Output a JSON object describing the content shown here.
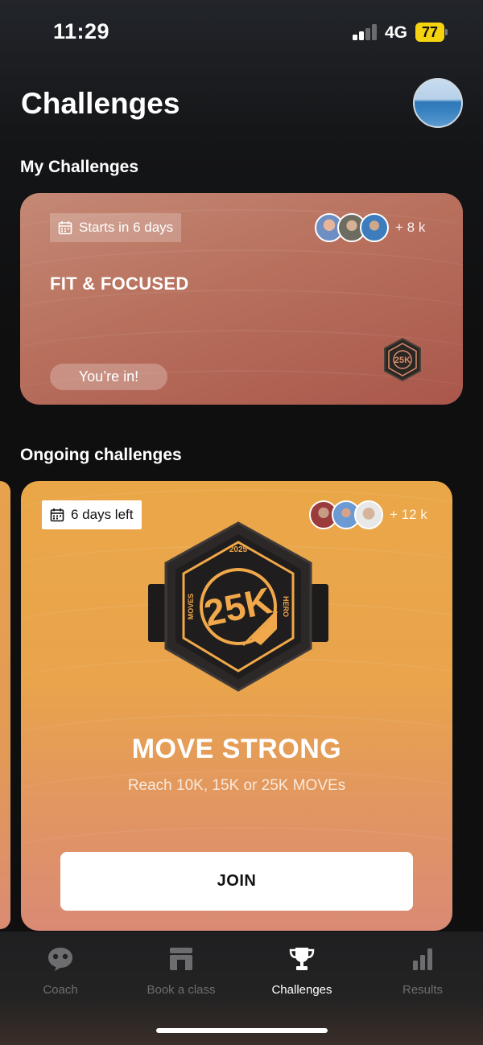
{
  "status_bar": {
    "time": "11:29",
    "network": "4G",
    "battery": "77"
  },
  "header": {
    "title": "Challenges"
  },
  "my_challenges": {
    "section_title": "My Challenges",
    "card": {
      "date_label": "Starts in 6 days",
      "participants": "+ 8 k",
      "title": "FIT & FOCUSED",
      "status": "You’re in!"
    }
  },
  "ongoing": {
    "section_title": "Ongoing challenges",
    "card": {
      "date_label": "6 days left",
      "participants": "+ 12 k",
      "badge": {
        "year": "2025",
        "value": "25K",
        "left": "MOVES",
        "right": "HERO"
      },
      "title": "MOVE STRONG",
      "subtitle": "Reach 10K, 15K or 25K MOVEs",
      "join_label": "JOIN"
    }
  },
  "tab_bar": {
    "tabs": [
      {
        "label": "Coach",
        "icon": "chat-bubble-icon",
        "active": false
      },
      {
        "label": "Book a class",
        "icon": "store-icon",
        "active": false
      },
      {
        "label": "Challenges",
        "icon": "trophy-icon",
        "active": true
      },
      {
        "label": "Results",
        "icon": "bar-chart-icon",
        "active": false
      }
    ]
  },
  "colors": {
    "accent_orange": "#eaa748",
    "card_terracotta": "#b8705d",
    "badge_orange": "#f0a84a"
  }
}
